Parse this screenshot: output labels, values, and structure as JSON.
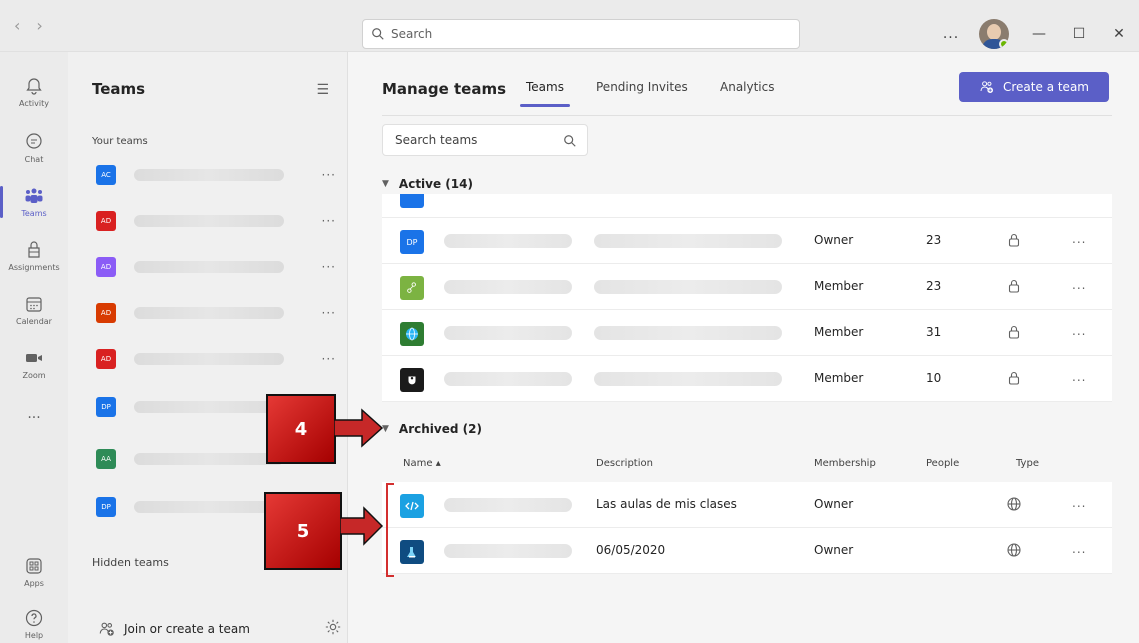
{
  "titlebar": {
    "search_placeholder": "Search",
    "more": "...",
    "nav_back": "‹",
    "nav_forward": "›"
  },
  "rail": [
    {
      "label": "Activity",
      "icon": "bell-icon"
    },
    {
      "label": "Chat",
      "icon": "chat-icon"
    },
    {
      "label": "Teams",
      "icon": "teams-icon",
      "active": true
    },
    {
      "label": "Assignments",
      "icon": "assignments-icon"
    },
    {
      "label": "Calendar",
      "icon": "calendar-icon"
    },
    {
      "label": "Zoom",
      "icon": "video-icon"
    },
    {
      "label": "...",
      "icon": "more-icon"
    },
    {
      "label": "Apps",
      "icon": "apps-icon"
    },
    {
      "label": "Help",
      "icon": "help-icon"
    }
  ],
  "teams_panel": {
    "title": "Teams",
    "your_teams": "Your teams",
    "hidden_teams": "Hidden teams",
    "join_label": "Join or create a team",
    "teams": [
      {
        "initials": "AC",
        "color": "#1a73e8"
      },
      {
        "initials": "AD",
        "color": "#d92121"
      },
      {
        "initials": "AD",
        "color": "#8b5cf6"
      },
      {
        "initials": "AD",
        "color": "#d83b01"
      },
      {
        "initials": "AD",
        "color": "#d92121"
      },
      {
        "initials": "DP",
        "color": "#1a73e8"
      },
      {
        "initials": "AA",
        "color": "#2e8b57"
      },
      {
        "initials": "DP",
        "color": "#1a73e8"
      }
    ]
  },
  "main": {
    "title": "Manage teams",
    "tabs": [
      "Teams",
      "Pending Invites",
      "Analytics"
    ],
    "create_button": "Create a team",
    "search_placeholder": "Search teams",
    "active_header": "Active (14)",
    "archived_header": "Archived (2)",
    "active_rows": [
      {
        "tile": "DP",
        "tile_color": "#1a73e8",
        "membership": "Owner",
        "people": "23",
        "type": "lock-icon"
      },
      {
        "tile": "",
        "tile_color": "#7cb342",
        "membership": "Member",
        "people": "23",
        "type": "lock-icon"
      },
      {
        "tile": "",
        "tile_color": "#2e7d32",
        "membership": "Member",
        "people": "31",
        "type": "lock-icon"
      },
      {
        "tile": "",
        "tile_color": "#1b1b1b",
        "membership": "Member",
        "people": "10",
        "type": "lock-icon"
      }
    ],
    "columns": {
      "name": "Name",
      "description": "Description",
      "membership": "Membership",
      "people": "People",
      "type": "Type"
    },
    "archived_rows": [
      {
        "tile_color": "#1ba1e2",
        "description": "Las aulas de mis clases",
        "membership": "Owner",
        "type": "globe-icon"
      },
      {
        "tile_color": "#0f4c81",
        "description": "06/05/2020",
        "membership": "Owner",
        "type": "globe-icon"
      }
    ],
    "row_more": "..."
  },
  "callouts": {
    "four": "4",
    "five": "5"
  }
}
